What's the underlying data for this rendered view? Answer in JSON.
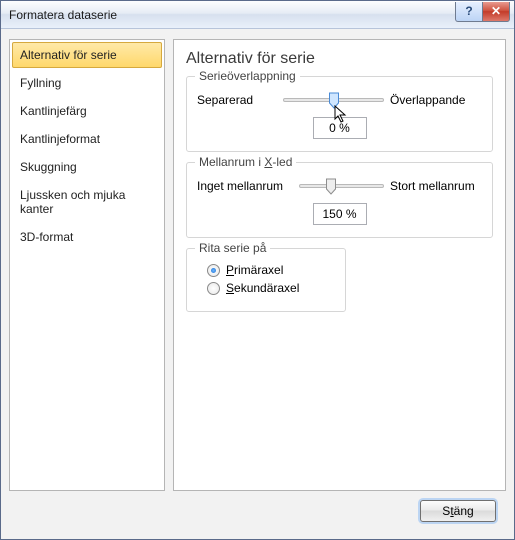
{
  "title": "Formatera dataserie",
  "sidebar": {
    "items": [
      {
        "label": "Alternativ för serie",
        "selected": true
      },
      {
        "label": "Fyllning"
      },
      {
        "label": "Kantlinjefärg"
      },
      {
        "label": "Kantlinjeformat"
      },
      {
        "label": "Skuggning"
      },
      {
        "label": "Ljussken och mjuka kanter"
      },
      {
        "label": "3D-format"
      }
    ]
  },
  "content": {
    "heading": "Alternativ för serie",
    "overlap": {
      "legend": "Serieöverlappning",
      "left": "Separerad",
      "right": "Överlappande",
      "value": "0 %"
    },
    "gap": {
      "legend_pre": "Mellanrum i ",
      "legend_key": "X",
      "legend_post": "-led",
      "left": "Inget mellanrum",
      "right": "Stort mellanrum",
      "value": "150 %"
    },
    "plot_on": {
      "legend": "Rita serie på",
      "primary_pre": "",
      "primary_key": "P",
      "primary_post": "rimäraxel",
      "secondary_pre": "",
      "secondary_key": "S",
      "secondary_post": "ekundäraxel",
      "selected": "primary"
    }
  },
  "footer": {
    "close_pre": "S",
    "close_key": "t",
    "close_post": "äng"
  }
}
